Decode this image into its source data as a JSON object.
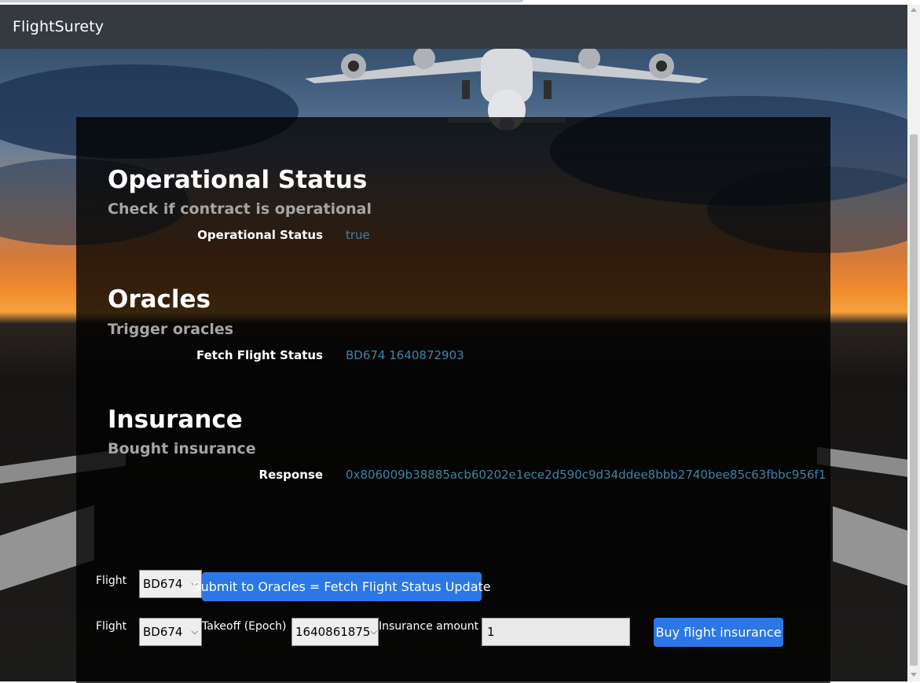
{
  "navbar": {
    "brand": "FlightSurety"
  },
  "sections": {
    "operational": {
      "title": "Operational Status",
      "subtitle": "Check if contract is operational",
      "label": "Operational Status",
      "value": "true"
    },
    "oracles": {
      "title": "Oracles",
      "subtitle": "Trigger oracles",
      "label": "Fetch Flight Status",
      "value": "BD674 1640872903"
    },
    "insurance": {
      "title": "Insurance",
      "subtitle": "Bought insurance",
      "label": "Response",
      "value": "0x806009b38885acb60202e1ece2d590c9d34ddee8bbb2740bee85c63fbbc956f1"
    }
  },
  "oracle_form": {
    "flight_label": "Flight",
    "flight_selected": "BD674",
    "submit_label": "Submit to Oracles = Fetch Flight Status Update"
  },
  "insurance_form": {
    "flight_label": "Flight",
    "flight_selected": "BD674",
    "takeoff_label": "Takeoff (Epoch)",
    "takeoff_selected": "1640861875",
    "amount_label": "Insurance amount",
    "amount_value": "1",
    "buy_label": "Buy flight insurance"
  },
  "colors": {
    "navbar": "#343a40",
    "accent_button": "#2b77e6",
    "value_text": "#3c83a8"
  },
  "icons": [
    "chevron-down-icon",
    "airplane-illustration"
  ]
}
